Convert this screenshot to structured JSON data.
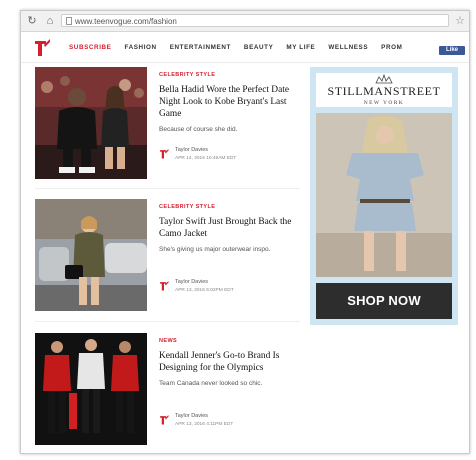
{
  "browser": {
    "url": "www.teenvogue.com/fashion"
  },
  "nav": {
    "items": [
      "SUBSCRIBE",
      "FASHION",
      "ENTERTAINMENT",
      "BEAUTY",
      "MY LIFE",
      "WELLNESS",
      "PROM"
    ],
    "fb_like": "Like"
  },
  "articles": [
    {
      "kicker": "CELEBRITY STYLE",
      "headline": "Bella Hadid Wore the Perfect Date Night Look to Kobe Bryant's Last Game",
      "dek": "Because of course she did.",
      "author": "Taylor Davies",
      "date": "APR 14, 2016 10:49AM EDT"
    },
    {
      "kicker": "CELEBRITY STYLE",
      "headline": "Taylor Swift Just Brought Back the Camo Jacket",
      "dek": "She's giving us major outerwear inspo.",
      "author": "Taylor Davies",
      "date": "APR 13, 2016 5:02PM EDT"
    },
    {
      "kicker": "NEWS",
      "headline": "Kendall Jenner's Go-to Brand Is Designing for the Olympics",
      "dek": "Team Canada never looked so chic.",
      "author": "Taylor Davies",
      "date": "APR 13, 2016 4:11PM EDT"
    }
  ],
  "ad": {
    "brand": "STILLMANSTREET",
    "city": "NEW YORK",
    "cta": "SHOP NOW",
    "background": "#cfe6f2"
  },
  "colors": {
    "accent": "#d62030"
  }
}
